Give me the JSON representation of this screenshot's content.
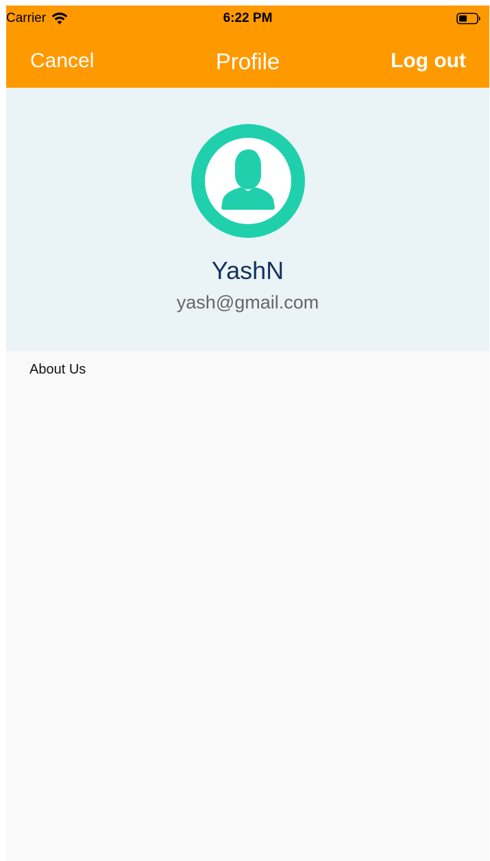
{
  "status_bar": {
    "carrier": "Carrier",
    "time": "6:22 PM",
    "wifi_icon": "wifi-icon",
    "battery_icon": "battery-icon"
  },
  "nav": {
    "cancel_label": "Cancel",
    "title": "Profile",
    "logout_label": "Log out"
  },
  "profile": {
    "avatar_icon": "user-avatar-icon",
    "name": "YashN",
    "email": "yash@gmail.com"
  },
  "menu": {
    "items": [
      {
        "label": "About Us"
      }
    ]
  },
  "colors": {
    "header_bg": "#ff9900",
    "profile_bg": "#eaf3f6",
    "page_bg": "#f9f9f9",
    "avatar_accent": "#20d0ad",
    "name_text": "#16325c",
    "email_text": "#666666"
  }
}
